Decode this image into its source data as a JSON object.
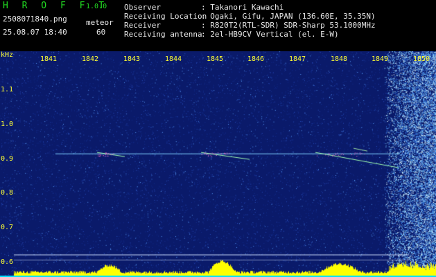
{
  "header": {
    "app_name": "H R O F F T",
    "version": "1.0.0",
    "filename": "2508071840.png",
    "mode_label": "meteor",
    "datetime": "25.08.07 18:40",
    "mode_value": "60",
    "fields": [
      {
        "label": "Observer",
        "value": ": Takanori Kawachi"
      },
      {
        "label": "Receiving Location",
        "value": ": Ogaki, Gifu, JAPAN (136.60E, 35.35N)"
      },
      {
        "label": "Receiver",
        "value": ": R820T2(RTL-SDR) SDR-Sharp 53.1000MHz"
      },
      {
        "label": "Receiving antenna",
        "value": ": 2el-HB9CV Vertical (el. E-W)"
      }
    ]
  },
  "spectrogram": {
    "y_unit": "kHz",
    "time_ticks": [
      "1841",
      "1842",
      "1843",
      "1844",
      "1845",
      "1846",
      "1847",
      "1848",
      "1849",
      "1850"
    ],
    "freq_ticks": [
      "1.1",
      "1.0",
      "0.9",
      "0.8",
      "0.7",
      "0.6"
    ],
    "freq_range_khz": [
      0.58,
      1.18
    ],
    "carrier_freq_khz": 0.913,
    "colors": {
      "background": "#0a1a6a",
      "trace": "#7fd0ff",
      "echo": "#ff66cc",
      "activity": "#ffff00",
      "baseline": "#00e0ff",
      "axis_text": "#ffff33",
      "header_green": "#22dd22"
    }
  }
}
